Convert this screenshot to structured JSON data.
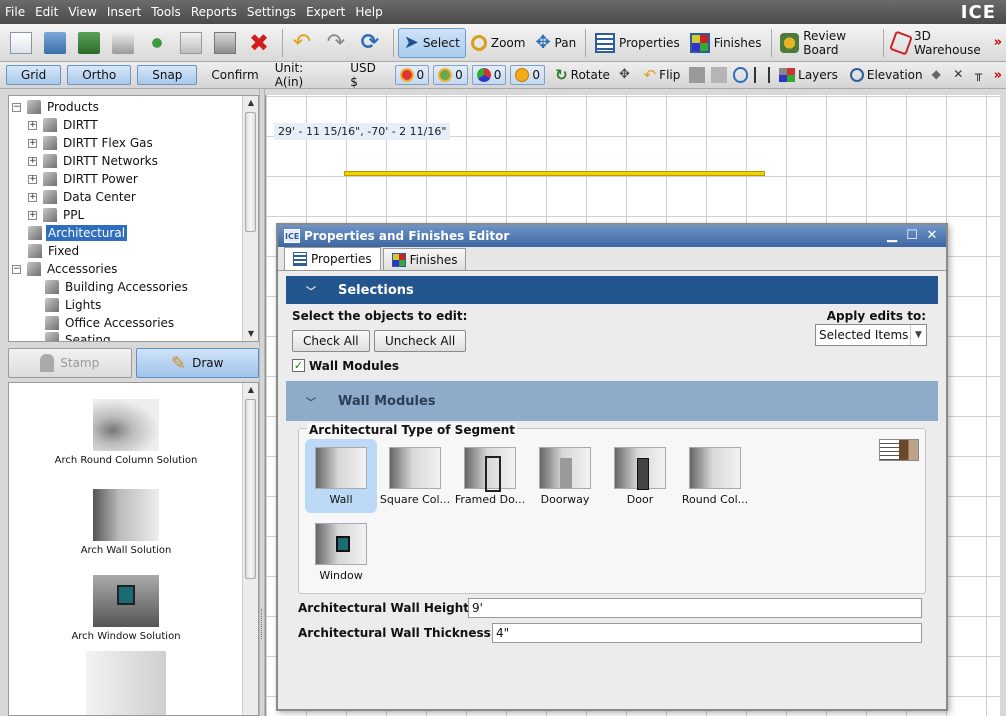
{
  "menubar": {
    "items": [
      "File",
      "Edit",
      "View",
      "Insert",
      "Tools",
      "Reports",
      "Settings",
      "Expert",
      "Help"
    ],
    "brand": "ICE"
  },
  "toolbar": {
    "select": "Select",
    "zoom": "Zoom",
    "pan": "Pan",
    "properties": "Properties",
    "finishes": "Finishes",
    "review_board": "Review Board",
    "warehouse": "3D Warehouse",
    "more": "»"
  },
  "toolbar2": {
    "grid": "Grid",
    "ortho": "Ortho",
    "snap": "Snap",
    "confirm": "Confirm",
    "unit": "Unit: A(in)",
    "currency": "USD $",
    "counts": [
      "0",
      "0",
      "0",
      "0"
    ],
    "rotate": "Rotate",
    "flip": "Flip",
    "layers": "Layers",
    "elevation": "Elevation",
    "more": "»"
  },
  "tree": {
    "root": "Products",
    "items": [
      {
        "label": "DIRTT",
        "expander": "+"
      },
      {
        "label": "DIRTT Flex Gas",
        "expander": "+"
      },
      {
        "label": "DIRTT Networks",
        "expander": "+"
      },
      {
        "label": "DIRTT Power",
        "expander": "+"
      },
      {
        "label": "Data Center",
        "expander": "+"
      },
      {
        "label": "PPL",
        "expander": "+"
      }
    ],
    "selected": "Architectural",
    "fixed": "Fixed",
    "accessories": "Accessories",
    "accessory_items": [
      "Building Accessories",
      "Lights",
      "Office Accessories",
      "Seating"
    ]
  },
  "mode_buttons": {
    "stamp": "Stamp",
    "draw": "Draw"
  },
  "solutions": [
    {
      "label": "Arch Round Column Solution"
    },
    {
      "label": "Arch Wall Solution"
    },
    {
      "label": "Arch Window Solution"
    }
  ],
  "canvas": {
    "coordinates": "29' - 11 15/16\", -70' - 2 11/16\""
  },
  "dialog": {
    "title": "Properties and Finishes Editor",
    "logo": "ICE",
    "tabs": [
      "Properties",
      "Finishes"
    ],
    "selections_header": "Selections",
    "select_objects_label": "Select the objects to edit:",
    "apply_edits_label": "Apply edits to:",
    "apply_edits_value": "Selected Items",
    "check_all": "Check All",
    "uncheck_all": "Uncheck All",
    "wall_modules_check": "Wall Modules",
    "wall_modules_header": "Wall Modules",
    "type_group_label": "Architectural Type of Segment",
    "types": [
      "Wall",
      "Square Col...",
      "Framed Do...",
      "Doorway",
      "Door",
      "Round Col...",
      "Window"
    ],
    "height_label": "Architectural Wall Height",
    "height_value": "9'",
    "thickness_label": "Architectural Wall Thickness",
    "thickness_value": "4\""
  },
  "colors": {
    "accent": "#23568f",
    "wall_line": "#f0d200",
    "selection": "#2f6ebd"
  }
}
